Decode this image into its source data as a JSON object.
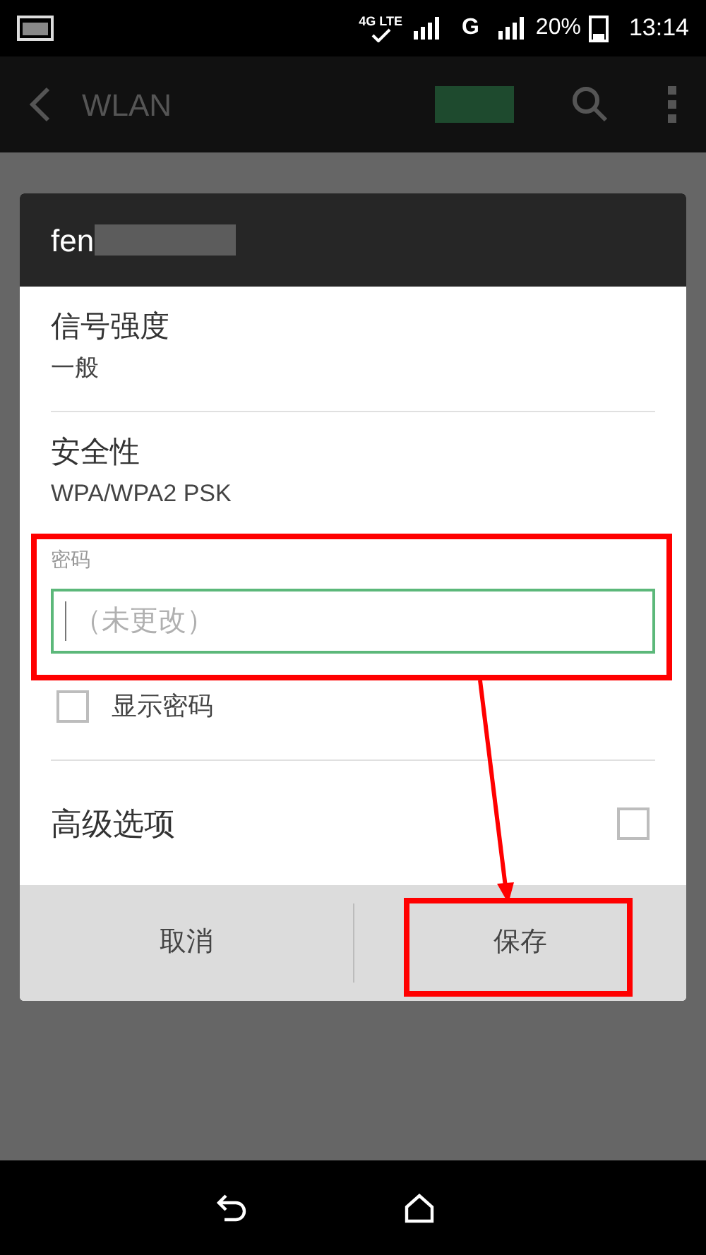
{
  "status_bar": {
    "network": "4G LTE",
    "sim2_type": "G",
    "battery": "20%",
    "time": "13:14"
  },
  "app_bar": {
    "title": "WLAN",
    "wifi_switch": {
      "on": true
    }
  },
  "dialog": {
    "title": "fen",
    "fields": [
      {
        "label": "信号强度",
        "value": "一般"
      },
      {
        "label": "安全性",
        "value": "WPA/WPA2 PSK"
      }
    ],
    "password": {
      "label": "密码",
      "placeholder": "（未更改）"
    },
    "show_password": {
      "label": "显示密码",
      "checked": false
    },
    "advanced": {
      "label": "高级选项",
      "checked": false
    },
    "buttons": [
      "取消",
      "保存"
    ]
  }
}
